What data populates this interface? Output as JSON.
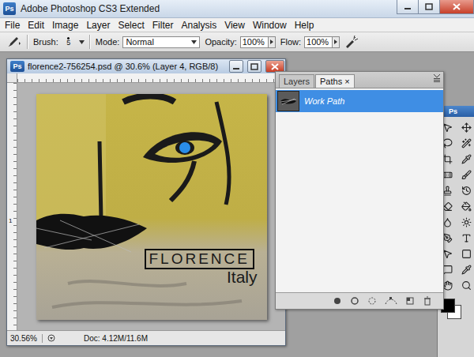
{
  "window": {
    "title": "Adobe Photoshop CS3 Extended",
    "logo": "Ps"
  },
  "menu": [
    "File",
    "Edit",
    "Image",
    "Layer",
    "Select",
    "Filter",
    "Analysis",
    "View",
    "Window",
    "Help"
  ],
  "options": {
    "brush_label": "Brush:",
    "brush_size": "5",
    "mode_label": "Mode:",
    "mode": "Normal",
    "opacity_label": "Opacity:",
    "opacity": "100%",
    "flow_label": "Flow:",
    "flow": "100%"
  },
  "document": {
    "title": "florence2-756254.psd @ 30.6% (Layer 4, RGB/8)",
    "ruler_mark": "1",
    "canvas_title": "FLORENCE",
    "canvas_subtitle": "Italy",
    "zoom": "30.56%",
    "doc_size": "Doc: 4.12M/11.6M"
  },
  "panel": {
    "tabs": [
      {
        "label": "Layers",
        "selected": false
      },
      {
        "label": "Paths",
        "selected": true
      }
    ],
    "close": "×",
    "paths": [
      {
        "name": "Work Path",
        "selected": true
      }
    ]
  },
  "tools_panel": {
    "logo": "Ps"
  }
}
